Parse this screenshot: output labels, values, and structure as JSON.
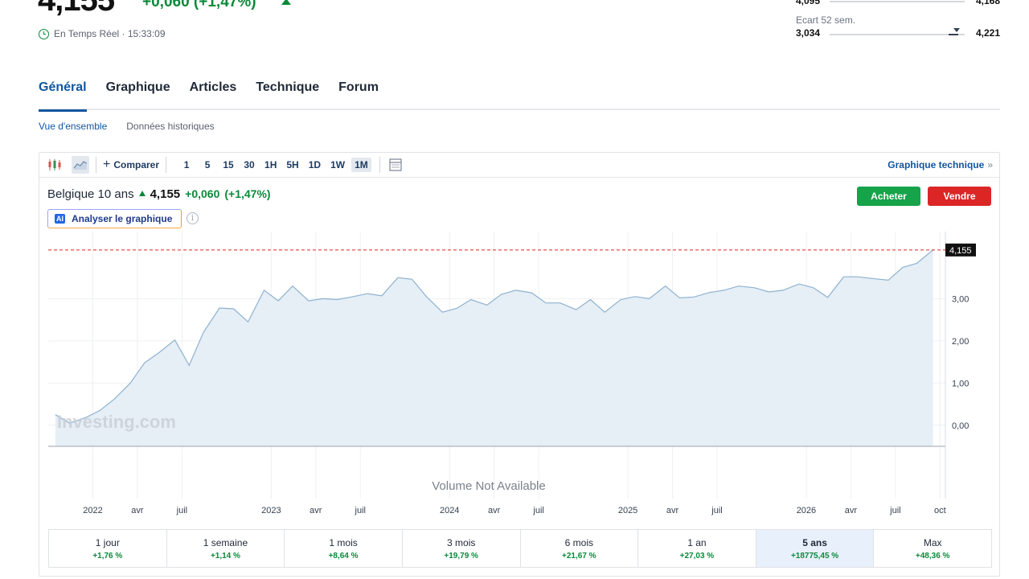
{
  "quote": {
    "price": "4,155",
    "change": "+0,060 (+1,47%)",
    "realtime_label": "En Temps Réel · 15:33:09"
  },
  "day_range": {
    "low": "4,095",
    "high": "4,168"
  },
  "range_52w": {
    "label": "Ecart 52 sem.",
    "low": "3,034",
    "high": "4,221"
  },
  "tabs": [
    {
      "label": "Général",
      "active": true
    },
    {
      "label": "Graphique"
    },
    {
      "label": "Articles"
    },
    {
      "label": "Technique"
    },
    {
      "label": "Forum"
    }
  ],
  "subtabs": [
    {
      "label": "Vue d'ensemble",
      "active": true
    },
    {
      "label": "Données historiques"
    }
  ],
  "toolbar": {
    "compare_label": "Comparer",
    "intervals": [
      "1",
      "5",
      "15",
      "30",
      "1H",
      "5H",
      "1D",
      "1W",
      "1M"
    ],
    "active_interval": "1M",
    "technical_link": "Graphique technique",
    "technical_chevron": "»"
  },
  "instrument": {
    "name": "Belgique 10 ans",
    "price": "4,155",
    "change": "+0,060",
    "change_pct": "(+1,47%)"
  },
  "actions": {
    "buy": "Acheter",
    "sell": "Vendre"
  },
  "analyse_label": "Analyser le graphique",
  "ai_badge": "AI",
  "info_glyph": "i",
  "watermark": "Investing.com",
  "volume_note": "Volume Not Available",
  "current_label": "4,155",
  "colors": {
    "up": "#0a8a3a",
    "down": "#dc2626",
    "accent": "#1256a0",
    "area": "#e6eef6",
    "line": "#8fb2cf"
  },
  "chart_data": {
    "type": "area",
    "ylim": [
      -0.5,
      4.4
    ],
    "y_ticks": [
      "0,00",
      "1,00",
      "2,00",
      "3,00"
    ],
    "y_tick_values": [
      0,
      1,
      2,
      3
    ],
    "x_ticks": [
      {
        "label": "2022",
        "x": 2022.0
      },
      {
        "label": "avr",
        "x": 2022.25
      },
      {
        "label": "juil",
        "x": 2022.5
      },
      {
        "label": "2023",
        "x": 2023.0
      },
      {
        "label": "avr",
        "x": 2023.25
      },
      {
        "label": "juil",
        "x": 2023.5
      },
      {
        "label": "2024",
        "x": 2024.0
      },
      {
        "label": "avr",
        "x": 2024.25
      },
      {
        "label": "juil",
        "x": 2024.5
      },
      {
        "label": "2025",
        "x": 2025.0
      },
      {
        "label": "avr",
        "x": 2025.25
      },
      {
        "label": "juil",
        "x": 2025.5
      },
      {
        "label": "2026",
        "x": 2026.0
      },
      {
        "label": "avr",
        "x": 2026.25
      },
      {
        "label": "juil",
        "x": 2026.5
      },
      {
        "label": "oct",
        "x": 2026.75
      }
    ],
    "xlim": [
      2021.75,
      2026.78
    ],
    "last_value": 4.155,
    "x": [
      2021.79,
      2021.87,
      2021.96,
      2022.04,
      2022.12,
      2022.21,
      2022.29,
      2022.37,
      2022.46,
      2022.54,
      2022.62,
      2022.71,
      2022.79,
      2022.87,
      2022.96,
      2023.04,
      2023.12,
      2023.21,
      2023.29,
      2023.37,
      2023.46,
      2023.54,
      2023.62,
      2023.71,
      2023.79,
      2023.87,
      2023.96,
      2024.04,
      2024.12,
      2024.21,
      2024.29,
      2024.37,
      2024.46,
      2024.54,
      2024.62,
      2024.71,
      2024.79,
      2024.87,
      2024.96,
      2025.04,
      2025.12,
      2025.21,
      2025.29,
      2025.37,
      2025.46,
      2025.54,
      2025.62,
      2025.71,
      2025.79,
      2025.87,
      2025.96,
      2026.04,
      2026.12,
      2026.21,
      2026.29,
      2026.37,
      2026.46,
      2026.54,
      2026.62,
      2026.71
    ],
    "values": [
      0.25,
      0.05,
      0.18,
      0.35,
      0.62,
      1.0,
      1.48,
      1.72,
      2.02,
      1.42,
      2.2,
      2.78,
      2.76,
      2.45,
      3.2,
      2.95,
      3.3,
      2.95,
      3.0,
      2.98,
      3.05,
      3.12,
      3.07,
      3.5,
      3.46,
      3.05,
      2.68,
      2.77,
      2.98,
      2.85,
      3.1,
      3.2,
      3.14,
      2.9,
      2.9,
      2.74,
      2.98,
      2.68,
      2.98,
      3.05,
      3.0,
      3.3,
      3.02,
      3.04,
      3.15,
      3.2,
      3.3,
      3.26,
      3.16,
      3.2,
      3.35,
      3.26,
      3.03,
      3.52,
      3.52,
      3.48,
      3.44,
      3.74,
      3.84,
      4.155
    ]
  },
  "periods": [
    {
      "label": "1 jour",
      "value": "+1,76 %"
    },
    {
      "label": "1 semaine",
      "value": "+1,14 %"
    },
    {
      "label": "1 mois",
      "value": "+8,64 %"
    },
    {
      "label": "3 mois",
      "value": "+19,79 %"
    },
    {
      "label": "6 mois",
      "value": "+21,67 %"
    },
    {
      "label": "1 an",
      "value": "+27,03 %"
    },
    {
      "label": "5 ans",
      "value": "+18775,45 %",
      "active": true
    },
    {
      "label": "Max",
      "value": "+48,36 %"
    }
  ]
}
